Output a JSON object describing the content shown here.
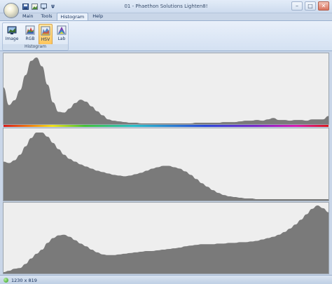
{
  "window": {
    "title": "01 - Phaethon Solutions Lighten8!"
  },
  "quick_access": [
    {
      "icon": "save-icon"
    },
    {
      "icon": "image-icon"
    },
    {
      "icon": "monitor-icon"
    },
    {
      "icon": "dropdown-arrow-icon"
    }
  ],
  "tabs": [
    {
      "label": "Main",
      "active": false
    },
    {
      "label": "Tools",
      "active": false
    },
    {
      "label": "Histogram",
      "active": true
    },
    {
      "label": "Help",
      "active": false
    }
  ],
  "ribbon": {
    "group_label": "Histogram",
    "buttons": [
      {
        "label": "Image",
        "icon": "image-histogram-icon",
        "active": false
      },
      {
        "label": "RGB",
        "icon": "rgb-histogram-icon",
        "active": false
      },
      {
        "label": "HSV",
        "icon": "hsv-histogram-icon",
        "active": true
      },
      {
        "label": "Lab",
        "icon": "lab-histogram-icon",
        "active": false
      }
    ]
  },
  "histograms": [
    {
      "channel": "hue",
      "levels": [
        0.54,
        0.28,
        0.35,
        0.5,
        0.72,
        0.93,
        0.98,
        0.85,
        0.58,
        0.32,
        0.18,
        0.17,
        0.23,
        0.31,
        0.36,
        0.33,
        0.26,
        0.19,
        0.13,
        0.07,
        0.05,
        0.04,
        0.03,
        0.02,
        0.02,
        0.01,
        0.01,
        0.01,
        0.01,
        0.01,
        0.01,
        0.01,
        0.01,
        0.01,
        0.01,
        0.02,
        0.02,
        0.02,
        0.02,
        0.02,
        0.03,
        0.03,
        0.03,
        0.04,
        0.05,
        0.05,
        0.06,
        0.05,
        0.07,
        0.09,
        0.06,
        0.06,
        0.05,
        0.06,
        0.06,
        0.05,
        0.07,
        0.07,
        0.07,
        0.12
      ]
    },
    {
      "channel": "saturation",
      "levels": [
        0.56,
        0.54,
        0.58,
        0.66,
        0.78,
        0.9,
        0.98,
        0.98,
        0.92,
        0.83,
        0.74,
        0.66,
        0.6,
        0.56,
        0.52,
        0.49,
        0.46,
        0.43,
        0.41,
        0.39,
        0.37,
        0.36,
        0.35,
        0.36,
        0.38,
        0.4,
        0.43,
        0.46,
        0.48,
        0.5,
        0.5,
        0.48,
        0.46,
        0.42,
        0.37,
        0.31,
        0.25,
        0.2,
        0.15,
        0.11,
        0.08,
        0.06,
        0.05,
        0.04,
        0.03,
        0.03,
        0.02,
        0.02,
        0.02,
        0.02,
        0.02,
        0.02,
        0.02,
        0.02,
        0.02,
        0.02,
        0.02,
        0.02,
        0.02,
        0.02
      ]
    },
    {
      "channel": "value",
      "levels": [
        0.02,
        0.04,
        0.07,
        0.08,
        0.14,
        0.22,
        0.29,
        0.35,
        0.45,
        0.52,
        0.56,
        0.57,
        0.54,
        0.49,
        0.44,
        0.4,
        0.35,
        0.31,
        0.28,
        0.27,
        0.27,
        0.28,
        0.29,
        0.3,
        0.31,
        0.32,
        0.33,
        0.33,
        0.34,
        0.35,
        0.36,
        0.37,
        0.38,
        0.4,
        0.41,
        0.42,
        0.43,
        0.43,
        0.43,
        0.44,
        0.44,
        0.45,
        0.45,
        0.46,
        0.46,
        0.47,
        0.48,
        0.5,
        0.52,
        0.54,
        0.57,
        0.61,
        0.66,
        0.72,
        0.79,
        0.87,
        0.95,
        1.0,
        0.96,
        0.9
      ]
    }
  ],
  "statusbar": {
    "dimensions": "1230 x 819"
  },
  "colors": {
    "histogram_fill": "#7a7a7a",
    "histogram_background": "#eeeeee"
  }
}
